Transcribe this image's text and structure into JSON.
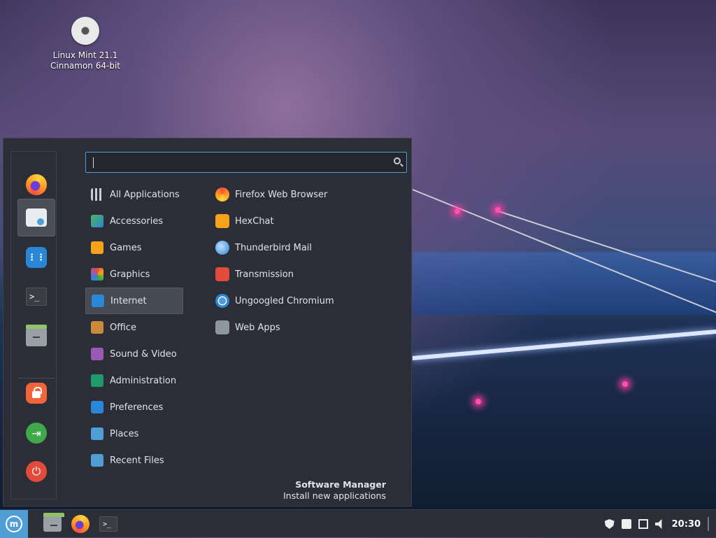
{
  "desktop": {
    "icon_label_line1": "Linux Mint 21.1",
    "icon_label_line2": "Cinnamon 64-bit"
  },
  "menu": {
    "search": {
      "value": "",
      "placeholder": ""
    },
    "favorites": [
      {
        "name": "Firefox",
        "icon": "firefox-icon"
      },
      {
        "name": "Software Manager",
        "icon": "software-manager-icon"
      },
      {
        "name": "System Settings",
        "icon": "settings-icon"
      },
      {
        "name": "Terminal",
        "icon": "terminal-icon"
      },
      {
        "name": "Files",
        "icon": "files-icon"
      }
    ],
    "session": [
      {
        "name": "Lock Screen",
        "icon": "lock-icon"
      },
      {
        "name": "Logout",
        "icon": "logout-icon"
      },
      {
        "name": "Quit",
        "icon": "power-icon"
      }
    ],
    "categories": [
      {
        "label": "All Applications",
        "icon": "grid-icon",
        "selected": false
      },
      {
        "label": "Accessories",
        "icon": "accessories-icon",
        "selected": false
      },
      {
        "label": "Games",
        "icon": "games-icon",
        "selected": false
      },
      {
        "label": "Graphics",
        "icon": "graphics-icon",
        "selected": false
      },
      {
        "label": "Internet",
        "icon": "internet-icon",
        "selected": true
      },
      {
        "label": "Office",
        "icon": "office-icon",
        "selected": false
      },
      {
        "label": "Sound & Video",
        "icon": "sound-video-icon",
        "selected": false
      },
      {
        "label": "Administration",
        "icon": "administration-icon",
        "selected": false
      },
      {
        "label": "Preferences",
        "icon": "preferences-icon",
        "selected": false
      },
      {
        "label": "Places",
        "icon": "folder-icon",
        "selected": false
      },
      {
        "label": "Recent Files",
        "icon": "recent-files-icon",
        "selected": false
      }
    ],
    "apps": [
      {
        "label": "Firefox Web Browser",
        "icon": "firefox-icon"
      },
      {
        "label": "HexChat",
        "icon": "hexchat-icon"
      },
      {
        "label": "Thunderbird Mail",
        "icon": "thunderbird-icon"
      },
      {
        "label": "Transmission",
        "icon": "transmission-icon"
      },
      {
        "label": "Ungoogled Chromium",
        "icon": "chromium-icon"
      },
      {
        "label": "Web Apps",
        "icon": "web-apps-icon"
      }
    ],
    "footer": {
      "title": "Software Manager",
      "subtitle": "Install new applications"
    }
  },
  "panel": {
    "clock": "20:30",
    "launchers": [
      "files-icon",
      "firefox-icon",
      "terminal-icon"
    ],
    "tray": [
      "shield-icon",
      "notes-icon",
      "network-icon",
      "volume-icon"
    ]
  },
  "colors": {
    "accent": "#4f9fd6",
    "menu_bg": "#2b2e37",
    "selected_bg": "#464a53"
  }
}
